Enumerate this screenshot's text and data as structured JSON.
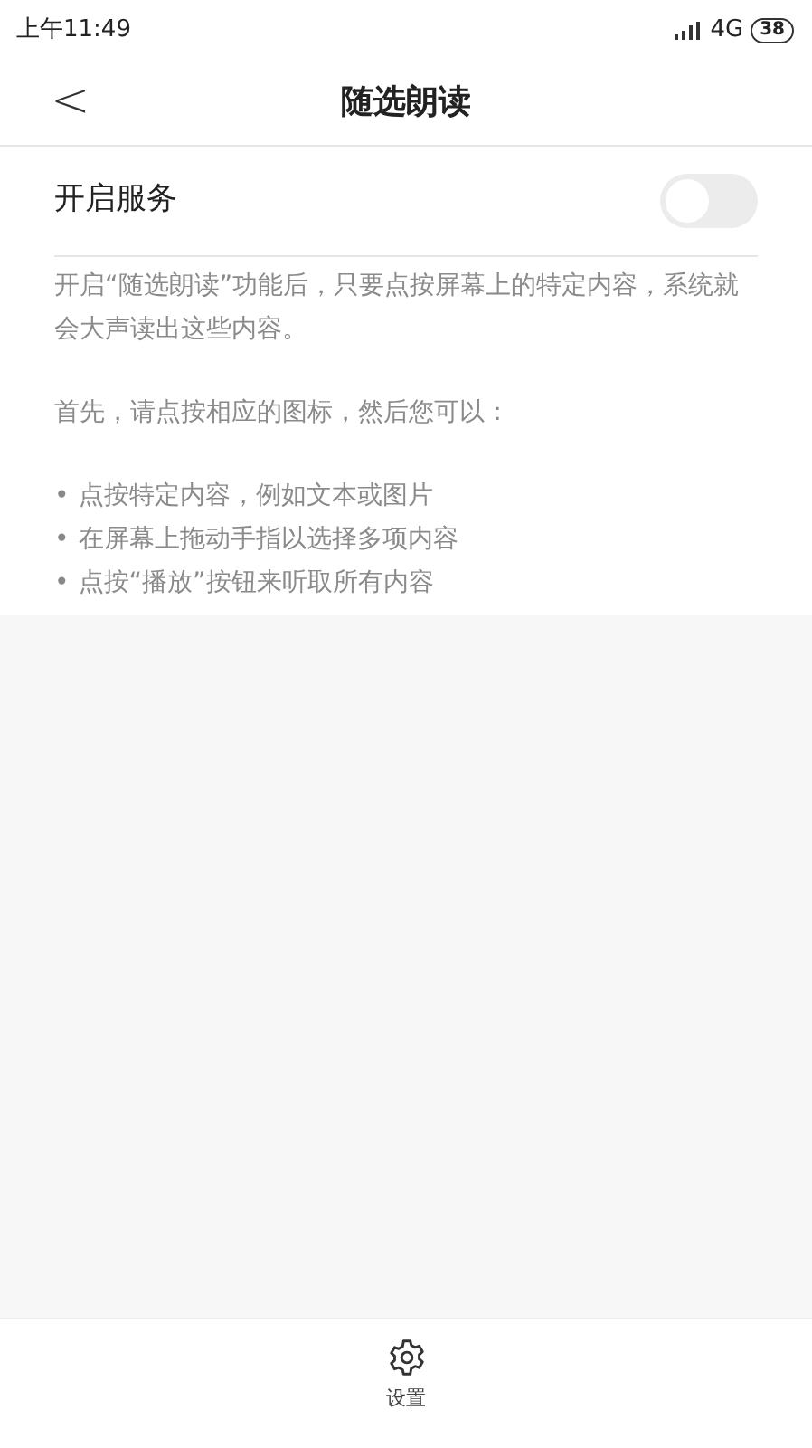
{
  "status_bar": {
    "time": "上午11:49",
    "network": "4G",
    "battery": "38"
  },
  "header": {
    "back": "<",
    "title": "随选朗读"
  },
  "service_toggle": {
    "label": "开启服务",
    "on": false
  },
  "description": [
    "开启“随选朗读”功能后，只要点按屏幕上的特定内容，系统就会大声读出这些内容。",
    "首先，请点按相应的图标，然后您可以："
  ],
  "bullets": [
    {
      "mark": "•",
      "text": "点按特定内容，例如文本或图片"
    },
    {
      "mark": "•",
      "text": "在屏幕上拖动手指以选择多项内容"
    },
    {
      "mark": "•",
      "text": "点按“播放”按钮来听取所有内容"
    }
  ],
  "bottom_bar": {
    "label": "设置"
  }
}
